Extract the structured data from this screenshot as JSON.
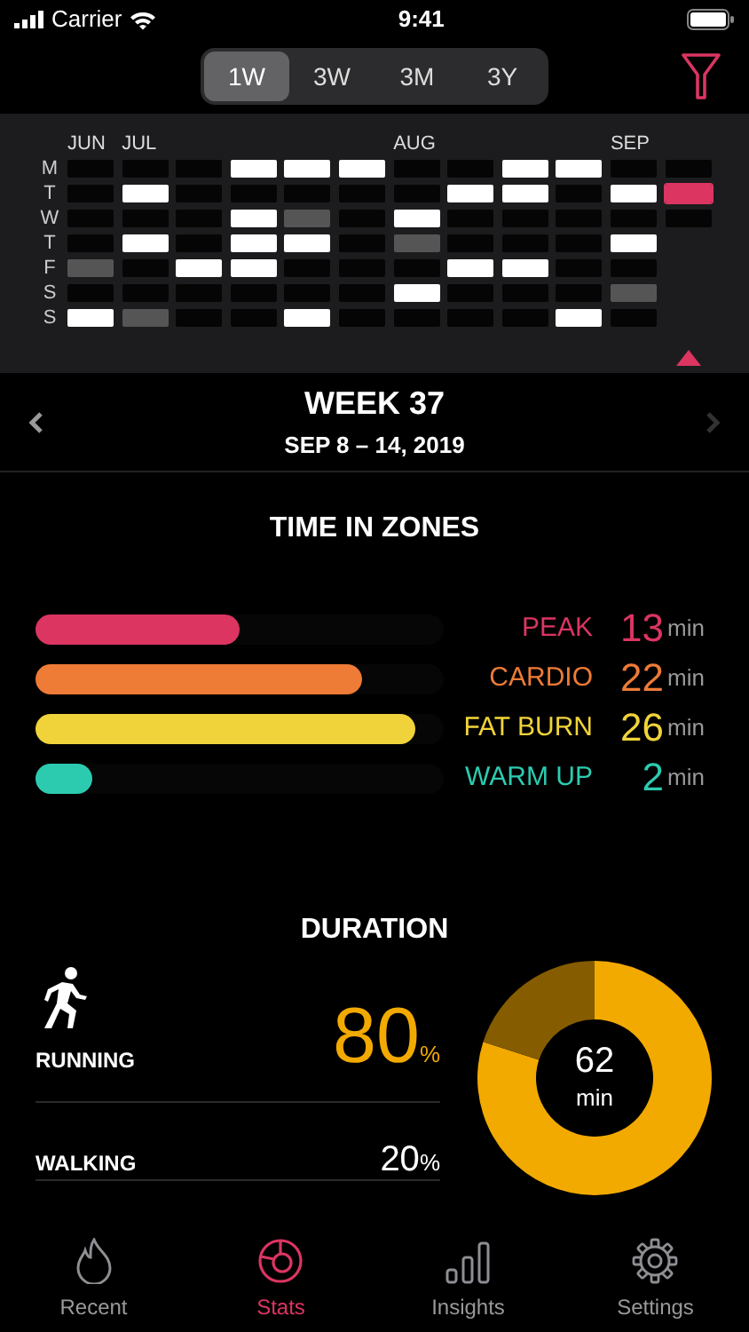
{
  "status_bar": {
    "carrier": "Carrier",
    "time": "9:41"
  },
  "range_tabs": [
    {
      "label": "1W",
      "selected": true
    },
    {
      "label": "3W",
      "selected": false
    },
    {
      "label": "3M",
      "selected": false
    },
    {
      "label": "3Y",
      "selected": false
    }
  ],
  "heatmap": {
    "day_labels": [
      "M",
      "T",
      "W",
      "T",
      "F",
      "S",
      "S"
    ],
    "weeks": [
      {
        "month": "JUN",
        "days": [
          {
            "color": "#050505",
            "selected": false
          },
          {
            "color": "#050505",
            "selected": false
          },
          {
            "color": "#050505",
            "selected": false
          },
          {
            "color": "#050505",
            "selected": false
          },
          {
            "color": "#555555",
            "selected": false
          },
          {
            "color": "#050505",
            "selected": false
          },
          {
            "color": "#ffffff",
            "selected": false
          }
        ]
      },
      {
        "month": "JUL",
        "days": [
          {
            "color": "#050505",
            "selected": false
          },
          {
            "color": "#ffffff",
            "selected": false
          },
          {
            "color": "#050505",
            "selected": false
          },
          {
            "color": "#ffffff",
            "selected": false
          },
          {
            "color": "#050505",
            "selected": false
          },
          {
            "color": "#050505",
            "selected": false
          },
          {
            "color": "#555555",
            "selected": false
          }
        ]
      },
      {
        "days": [
          {
            "color": "#050505",
            "selected": false
          },
          {
            "color": "#050505",
            "selected": false
          },
          {
            "color": "#050505",
            "selected": false
          },
          {
            "color": "#050505",
            "selected": false
          },
          {
            "color": "#ffffff",
            "selected": false
          },
          {
            "color": "#050505",
            "selected": false
          },
          {
            "color": "#050505",
            "selected": false
          }
        ]
      },
      {
        "days": [
          {
            "color": "#ffffff",
            "selected": false
          },
          {
            "color": "#050505",
            "selected": false
          },
          {
            "color": "#ffffff",
            "selected": false
          },
          {
            "color": "#ffffff",
            "selected": false
          },
          {
            "color": "#ffffff",
            "selected": false
          },
          {
            "color": "#050505",
            "selected": false
          },
          {
            "color": "#050505",
            "selected": false
          }
        ]
      },
      {
        "days": [
          {
            "color": "#ffffff",
            "selected": false
          },
          {
            "color": "#050505",
            "selected": false
          },
          {
            "color": "#555555",
            "selected": false
          },
          {
            "color": "#ffffff",
            "selected": false
          },
          {
            "color": "#050505",
            "selected": false
          },
          {
            "color": "#050505",
            "selected": false
          },
          {
            "color": "#ffffff",
            "selected": false
          }
        ]
      },
      {
        "days": [
          {
            "color": "#ffffff",
            "selected": false
          },
          {
            "color": "#050505",
            "selected": false
          },
          {
            "color": "#050505",
            "selected": false
          },
          {
            "color": "#050505",
            "selected": false
          },
          {
            "color": "#050505",
            "selected": false
          },
          {
            "color": "#050505",
            "selected": false
          },
          {
            "color": "#050505",
            "selected": false
          }
        ]
      },
      {
        "month": "AUG",
        "days": [
          {
            "color": "#050505",
            "selected": false
          },
          {
            "color": "#050505",
            "selected": false
          },
          {
            "color": "#ffffff",
            "selected": false
          },
          {
            "color": "#555555",
            "selected": false
          },
          {
            "color": "#050505",
            "selected": false
          },
          {
            "color": "#ffffff",
            "selected": false
          },
          {
            "color": "#050505",
            "selected": false
          }
        ]
      },
      {
        "days": [
          {
            "color": "#050505",
            "selected": false
          },
          {
            "color": "#ffffff",
            "selected": false
          },
          {
            "color": "#050505",
            "selected": false
          },
          {
            "color": "#050505",
            "selected": false
          },
          {
            "color": "#ffffff",
            "selected": false
          },
          {
            "color": "#050505",
            "selected": false
          },
          {
            "color": "#050505",
            "selected": false
          }
        ]
      },
      {
        "days": [
          {
            "color": "#ffffff",
            "selected": false
          },
          {
            "color": "#ffffff",
            "selected": false
          },
          {
            "color": "#050505",
            "selected": false
          },
          {
            "color": "#050505",
            "selected": false
          },
          {
            "color": "#ffffff",
            "selected": false
          },
          {
            "color": "#050505",
            "selected": false
          },
          {
            "color": "#050505",
            "selected": false
          }
        ]
      },
      {
        "days": [
          {
            "color": "#ffffff",
            "selected": false
          },
          {
            "color": "#050505",
            "selected": false
          },
          {
            "color": "#050505",
            "selected": false
          },
          {
            "color": "#050505",
            "selected": false
          },
          {
            "color": "#050505",
            "selected": false
          },
          {
            "color": "#050505",
            "selected": false
          },
          {
            "color": "#ffffff",
            "selected": false
          }
        ]
      },
      {
        "month": "SEP",
        "days": [
          {
            "color": "#050505",
            "selected": false
          },
          {
            "color": "#ffffff",
            "selected": false
          },
          {
            "color": "#050505",
            "selected": false
          },
          {
            "color": "#ffffff",
            "selected": false
          },
          {
            "color": "#050505",
            "selected": false
          },
          {
            "color": "#555555",
            "selected": false
          },
          {
            "color": "#050505",
            "selected": false
          }
        ]
      },
      {
        "days": [
          {
            "color": "#050505",
            "selected": false
          },
          {
            "color": "#dc3562",
            "selected": true
          },
          {
            "color": "#050505",
            "selected": false
          }
        ]
      }
    ]
  },
  "week_nav": {
    "title": "WEEK 37",
    "dates": "SEP 8 – 14, 2019",
    "prev_disabled": false,
    "next_disabled": true
  },
  "zones": {
    "title": "TIME IN ZONES",
    "items": [
      {
        "name": "PEAK",
        "color": "#dc3562",
        "level": 0.5,
        "value": "13",
        "unit": "min"
      },
      {
        "name": "CARDIO",
        "color": "#ee7b36",
        "level": 0.8,
        "value": "22",
        "unit": "min"
      },
      {
        "name": "FAT BURN",
        "color": "#f0d33a",
        "level": 0.93,
        "value": "26",
        "unit": "min"
      },
      {
        "name": "WARM UP",
        "color": "#2ccbb0",
        "level": 0.14,
        "value": "2",
        "unit": "min"
      }
    ]
  },
  "duration": {
    "title": "DURATION",
    "activities": [
      {
        "kind": "featured",
        "name": "RUNNING",
        "value": "80",
        "unit": "%"
      },
      {
        "kind": "plain",
        "name": "WALKING",
        "value": "20",
        "unit": "%"
      }
    ],
    "total": "62",
    "total_unit": "min",
    "chart_data": {
      "type": "donut",
      "series": [
        {
          "color": "#f2a900",
          "values": [
            80,
            20
          ]
        }
      ]
    }
  },
  "tab_bar": [
    {
      "label": "Recent",
      "selected": false
    },
    {
      "label": "Stats",
      "selected": true
    },
    {
      "label": "Insights",
      "selected": false
    },
    {
      "label": "Settings",
      "selected": false
    }
  ]
}
